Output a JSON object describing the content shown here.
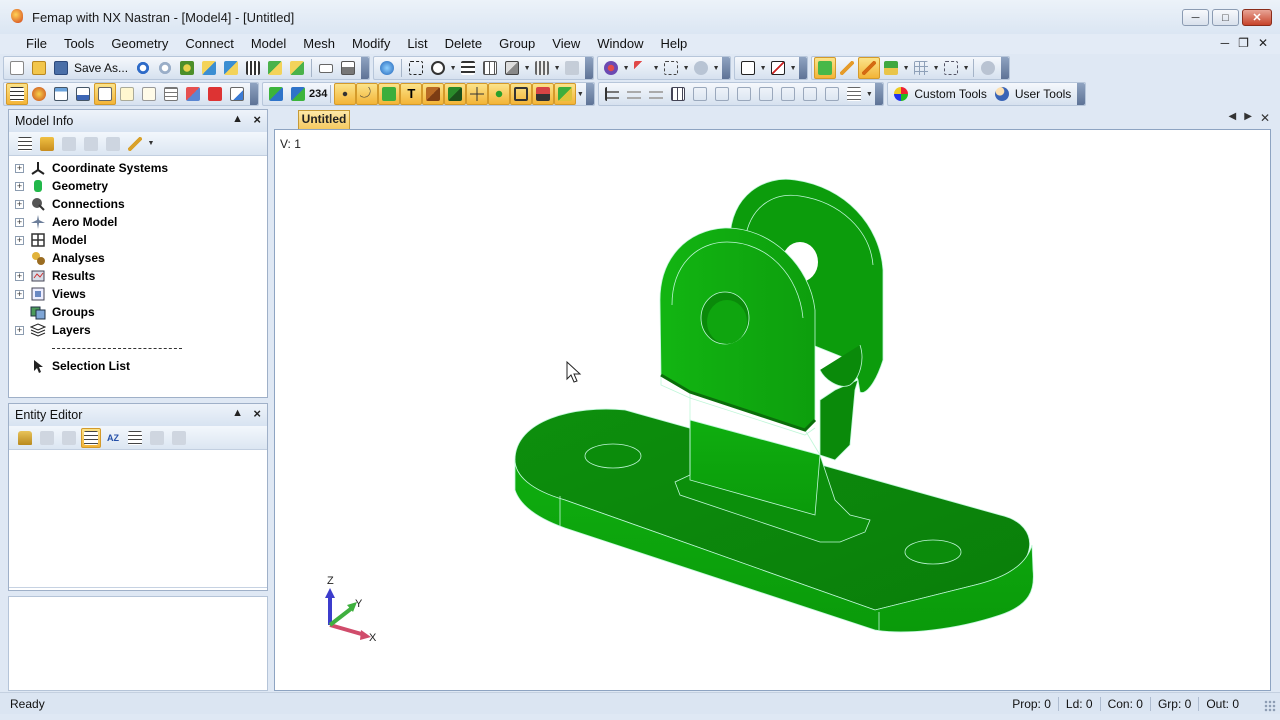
{
  "window": {
    "title": "Femap with NX Nastran - [Model4] - [Untitled]",
    "controls": [
      "minimize",
      "maximize",
      "close"
    ]
  },
  "menu": [
    "File",
    "Tools",
    "Geometry",
    "Connect",
    "Model",
    "Mesh",
    "Modify",
    "List",
    "Delete",
    "Group",
    "View",
    "Window",
    "Help"
  ],
  "toolbar": {
    "save_as_label": "Save As...",
    "counter_label": "234",
    "custom_tools_label": "Custom Tools",
    "user_tools_label": "User Tools"
  },
  "model_info": {
    "title": "Model Info",
    "tree": [
      {
        "label": "Coordinate Systems",
        "icon": "coordinate-systems-icon",
        "expandable": true
      },
      {
        "label": "Geometry",
        "icon": "geometry-icon",
        "expandable": true
      },
      {
        "label": "Connections",
        "icon": "connections-icon",
        "expandable": true
      },
      {
        "label": "Aero Model",
        "icon": "aero-model-icon",
        "expandable": true
      },
      {
        "label": "Model",
        "icon": "model-icon",
        "expandable": true
      },
      {
        "label": "Analyses",
        "icon": "analyses-icon",
        "expandable": false
      },
      {
        "label": "Results",
        "icon": "results-icon",
        "expandable": true
      },
      {
        "label": "Views",
        "icon": "views-icon",
        "expandable": true
      },
      {
        "label": "Groups",
        "icon": "groups-icon",
        "expandable": false
      },
      {
        "label": "Layers",
        "icon": "layers-icon",
        "expandable": true
      }
    ],
    "selection_list": "Selection List"
  },
  "entity_editor": {
    "title": "Entity Editor"
  },
  "document": {
    "tab": "Untitled",
    "view_label": "V: 1",
    "triad": {
      "z": "Z",
      "y": "Y",
      "x": "X"
    }
  },
  "colors": {
    "model_green": "#0a9b0a",
    "edge_cyan": "#bff7d8",
    "tab_active": "#f5c960"
  },
  "status": {
    "ready": "Ready",
    "prop": "Prop: 0",
    "ld": "Ld: 0",
    "con": "Con: 0",
    "grp": "Grp: 0",
    "out": "Out: 0"
  }
}
